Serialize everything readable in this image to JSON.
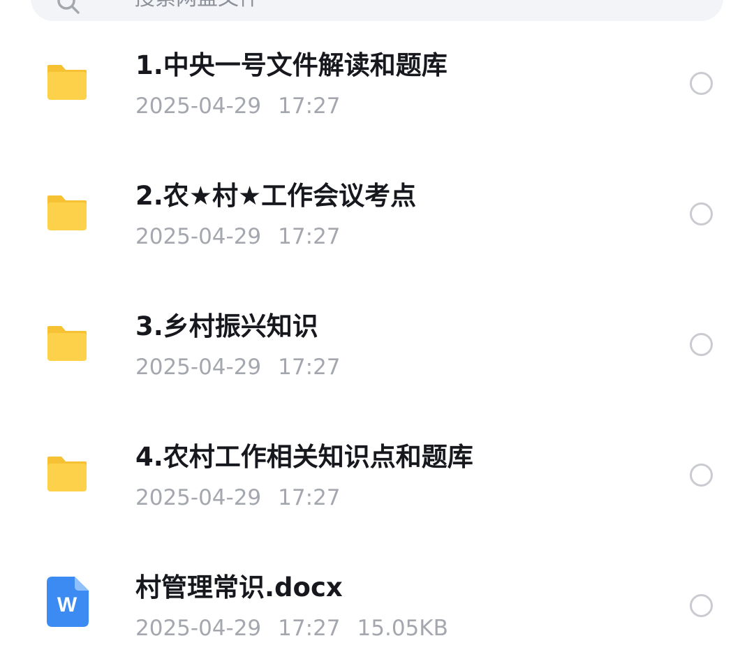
{
  "search": {
    "placeholder": "搜索网盘文件",
    "icon": "search-icon"
  },
  "colors": {
    "folder": "#fdd24a",
    "folder_tab": "#f6c233",
    "doc_icon": "#3b8bf2",
    "title_text": "#16181d",
    "meta_text": "#a4a7ae",
    "radio_border": "#c9cbd0"
  },
  "files": [
    {
      "type": "folder",
      "icon": "folder-icon",
      "name": "1.中央一号文件解读和题库",
      "date": "2025-04-29",
      "time": "17:27",
      "size": ""
    },
    {
      "type": "folder",
      "icon": "folder-icon",
      "name": "2.农★村★工作会议考点",
      "date": "2025-04-29",
      "time": "17:27",
      "size": ""
    },
    {
      "type": "folder",
      "icon": "folder-icon",
      "name": "3.乡村振兴知识",
      "date": "2025-04-29",
      "time": "17:27",
      "size": ""
    },
    {
      "type": "folder",
      "icon": "folder-icon",
      "name": "4.农村工作相关知识点和题库",
      "date": "2025-04-29",
      "time": "17:27",
      "size": ""
    },
    {
      "type": "doc",
      "icon": "word-doc-icon",
      "icon_letter": "W",
      "name": "村管理常识.docx",
      "date": "2025-04-29",
      "time": "17:27",
      "size": "15.05KB"
    }
  ]
}
